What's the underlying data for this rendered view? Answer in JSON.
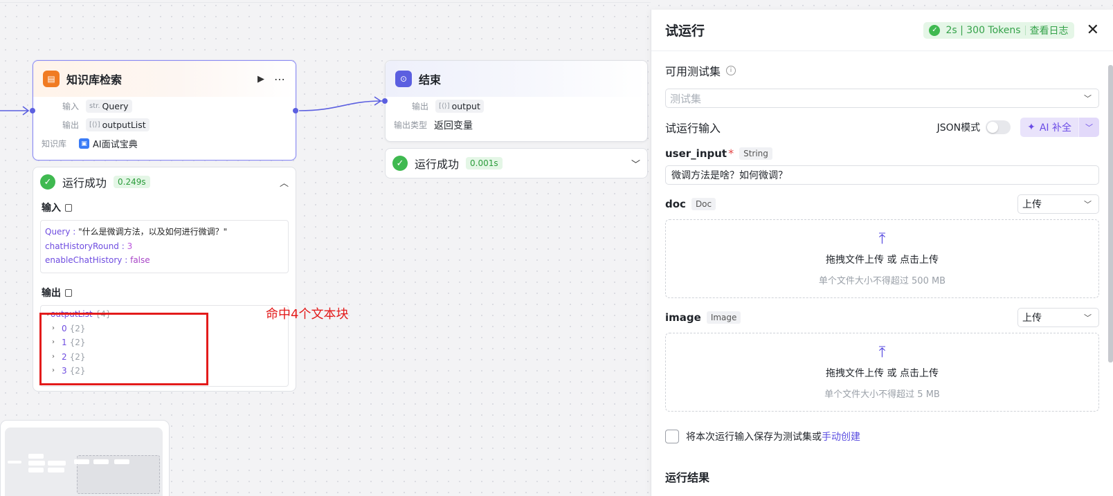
{
  "kb_node": {
    "title": "知识库检索",
    "input_label": "输入",
    "input_type": "str.",
    "input_value": "Query",
    "output_label": "输出",
    "output_type": "[⟨⟩]",
    "output_value": "outputList",
    "kb_label": "知识库",
    "kb_value": "AI面试宝典"
  },
  "end_node": {
    "title": "结束",
    "output_label": "输出",
    "output_type": "[⟨⟩]",
    "output_value": "output",
    "output_kind_label": "输出类型",
    "output_kind_value": "返回变量"
  },
  "kb_run": {
    "status": "运行成功",
    "time": "0.249s",
    "input_title": "输入",
    "input_lines": [
      {
        "key": "Query",
        "value": "\"什么是微调方法，以及如何进行微调？\""
      },
      {
        "key": "chatHistoryRound",
        "value": "3"
      },
      {
        "key": "enableChatHistory",
        "value": "false"
      }
    ],
    "output_title": "输出",
    "output_root": "outputList",
    "output_root_count": "{4}",
    "output_items": [
      {
        "key": "0",
        "count": "{2}"
      },
      {
        "key": "1",
        "count": "{2}"
      },
      {
        "key": "2",
        "count": "{2}"
      },
      {
        "key": "3",
        "count": "{2}"
      }
    ]
  },
  "end_run": {
    "status": "运行成功",
    "time": "0.001s"
  },
  "annotation": {
    "text": "命中4个文本块",
    "color": "#e31b1b"
  },
  "panel": {
    "title": "试运行",
    "status_time": "2s | 300 Tokens",
    "view_log": "查看日志",
    "testset_label": "可用测试集",
    "testset_placeholder": "测试集",
    "run_input_label": "试运行输入",
    "json_mode_label": "JSON模式",
    "ai_fill": "AI 补全",
    "user_input_name": "user_input",
    "user_input_type": "String",
    "user_input_value": "微调方法是啥？如何微调？",
    "doc_name": "doc",
    "doc_type": "Doc",
    "doc_mode": "上传",
    "doc_upload_main": "拖拽文件上传 或 点击上传",
    "doc_upload_sub": "单个文件大小不得超过 500 MB",
    "image_name": "image",
    "image_type": "Image",
    "image_mode": "上传",
    "image_upload_main": "拖拽文件上传 或 点击上传",
    "image_upload_sub": "单个文件大小不得超过 5 MB",
    "save_prefix": "将本次运行输入保存为测试集或",
    "save_link": "手动创建",
    "result_label": "运行结果"
  },
  "colors": {
    "accent": "#5b5fe0",
    "success": "#3fb950",
    "kb_icon": "#f07b22",
    "end_icon": "#5b5fe0"
  }
}
